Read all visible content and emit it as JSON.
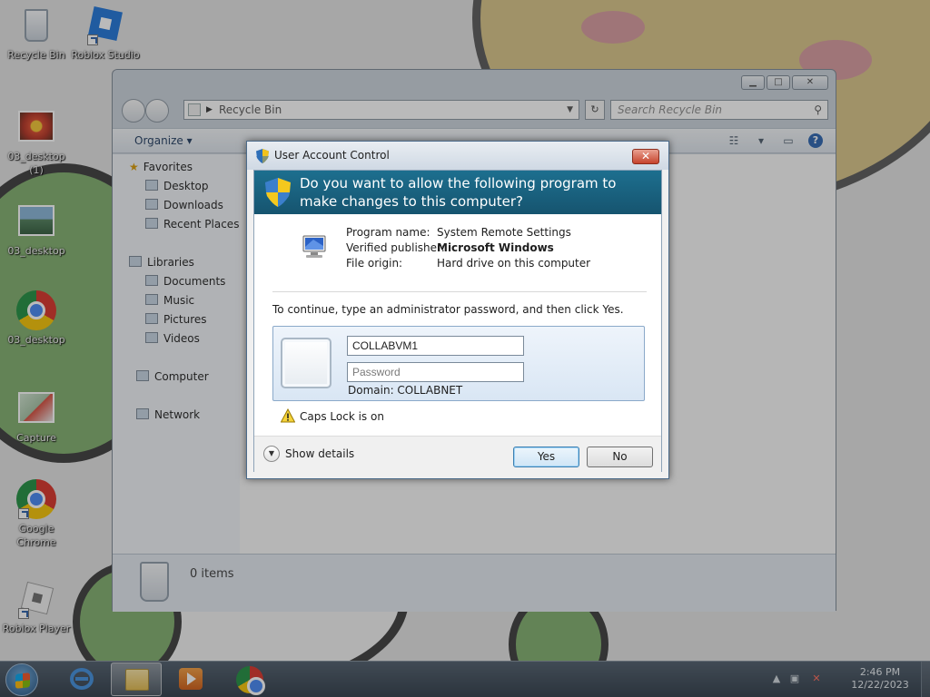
{
  "desktop": {
    "icons": [
      {
        "label": "Recycle Bin"
      },
      {
        "label": "Roblox Studio"
      },
      {
        "label": "03_desktop (1)"
      },
      {
        "label": "03_desktop"
      },
      {
        "label": "03_desktop"
      },
      {
        "label": "Capture"
      },
      {
        "label": "Google Chrome"
      },
      {
        "label": "Roblox Player"
      }
    ]
  },
  "explorer": {
    "address": "Recycle Bin",
    "search_placeholder": "Search Recycle Bin",
    "organize_label": "Organize ▾",
    "nav": {
      "favorites": "Favorites",
      "desktop": "Desktop",
      "downloads": "Downloads",
      "recent_places": "Recent Places",
      "libraries": "Libraries",
      "documents": "Documents",
      "music": "Music",
      "pictures": "Pictures",
      "videos": "Videos",
      "computer": "Computer",
      "network": "Network"
    },
    "items_count": "0 items"
  },
  "uac": {
    "title": "User Account Control",
    "question": "Do you want to allow the following program to make changes to this computer?",
    "program_name_label": "Program name:",
    "program_name": "System Remote Settings",
    "publisher_label": "Verified publisher:",
    "publisher": "Microsoft Windows",
    "origin_label": "File origin:",
    "origin": "Hard drive on this computer",
    "instruction": "To continue, type an administrator password, and then click Yes.",
    "username_value": "COLLABVM1",
    "password_placeholder": "Password",
    "domain": "Domain: COLLABNET",
    "caps_warning": "Caps Lock is on",
    "show_details": "Show details",
    "yes_label": "Yes",
    "no_label": "No",
    "close_glyph": "✕"
  },
  "taskbar": {
    "time": "2:46 PM",
    "date": "12/22/2023"
  },
  "colors": {
    "banner": "#1d6f8f",
    "taskbar": "#2d3a47"
  }
}
